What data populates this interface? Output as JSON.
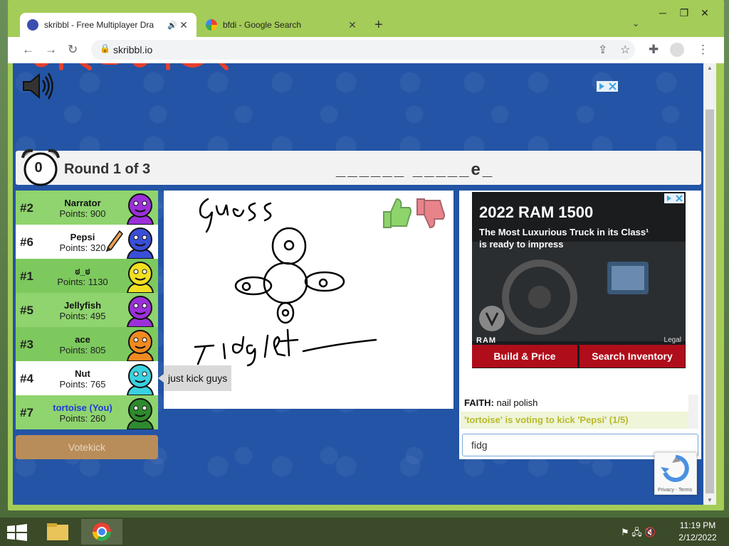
{
  "browser": {
    "tabs": [
      {
        "title": "skribbl - Free Multiplayer Dra",
        "favicon_color": "#3b4fb0"
      },
      {
        "title": "bfdi - Google Search",
        "favicon_color": "#4285f4"
      }
    ],
    "url": "skribbl.io",
    "new_tab": "+"
  },
  "game": {
    "timer": "0",
    "round_label": "Round 1 of 3",
    "word_hint": "______ _____e_",
    "votekick_label": "Votekick",
    "bubble_text": "just kick guys",
    "players": [
      {
        "rank": "#2",
        "name": "Narrator",
        "points": "Points: 900",
        "avatar_color": "#9b30d9"
      },
      {
        "rank": "#6",
        "name": "Pepsi",
        "points": "Points: 320",
        "avatar_color": "#3a4fd8"
      },
      {
        "rank": "#1",
        "name": "ಠ_ಠ",
        "points": "Points: 1130",
        "avatar_color": "#f0e020"
      },
      {
        "rank": "#5",
        "name": "Jellyfish",
        "points": "Points: 495",
        "avatar_color": "#9b30d9"
      },
      {
        "rank": "#3",
        "name": "ace",
        "points": "Points: 805",
        "avatar_color": "#f08a20"
      },
      {
        "rank": "#4",
        "name": "Nut",
        "points": "Points: 765",
        "avatar_color": "#3ad1e0"
      },
      {
        "rank": "#7",
        "name": "tortoise (You)",
        "points": "Points: 260",
        "avatar_color": "#2e8a2e"
      }
    ],
    "chat": [
      {
        "author": "FAITH:",
        "text": "nail polish"
      },
      {
        "text": "'tortoise' is voting to kick 'Pepsi' (1/5)"
      }
    ],
    "chat_input_value": "fidg"
  },
  "ad": {
    "headline": "2022 RAM 1500",
    "subtext": "The Most Luxurious Truck in its Class¹ is ready to impress",
    "brand": "RAM",
    "legal": "Legal",
    "button1": "Build & Price",
    "button2": "Search Inventory"
  },
  "recaptcha": {
    "links": "Privacy - Terms"
  },
  "taskbar": {
    "time": "11:19 PM",
    "date": "2/12/2022"
  }
}
